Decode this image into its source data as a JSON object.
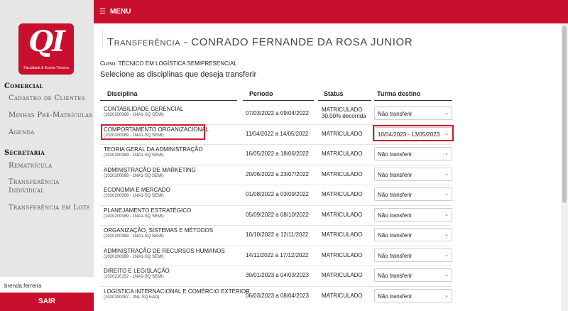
{
  "brand": {
    "logo_text": "QI",
    "logo_subtitle": "Faculdade & Escola Técnica",
    "color": "#c8102e"
  },
  "topbar": {
    "menu_label": "MENU"
  },
  "sidebar": {
    "groups": [
      {
        "title": "Comercial",
        "items": [
          "Cadastro de Clientes",
          "Minhas Pré-Matrículas",
          "Agenda"
        ]
      },
      {
        "title": "Secretaria",
        "items": [
          "Rematrícula",
          "Transferência Individual",
          "Transferência em Lote"
        ]
      }
    ],
    "username": "brenda.ferreira",
    "logout_label": "SAIR"
  },
  "page": {
    "title_prefix": "Transferência",
    "title_rest": " - CONRADO FERNANDE DA ROSA JUNIOR",
    "curso": "Curso: TÉCNICO EM LOGÍSTICA SEMIPRESENCIAL",
    "subheading": "Selecione as disciplinas que deseja transferir"
  },
  "table": {
    "headers": [
      "Disciplina",
      "Período",
      "Status",
      "Turma destino"
    ],
    "rows": [
      {
        "name": "CONTABILIDADE GERENCIAL",
        "code": "(1020200089 - 1NA1-SQ SEMI)",
        "periodo": "07/03/2022 a 09/04/2022",
        "status": "MATRICULADO",
        "status2": "30.00% decorrida",
        "destino": "Não transferir"
      },
      {
        "name": "COMPORTAMENTO ORGANIZACIONAL",
        "code": "(1020200089 - 1NA1-SQ SEMI)",
        "periodo": "11/04/2022 a 14/05/2022",
        "status": "MATRICULADO",
        "status2": "",
        "destino": "10/04/2023 - 13/05/2023"
      },
      {
        "name": "TEORIA GERAL DA ADMINISTRAÇÃO",
        "code": "(1020200089 - 1NA1-SQ SEMI)",
        "periodo": "16/05/2022 a 18/06/2022",
        "status": "MATRICULADO",
        "status2": "",
        "destino": "Não transferir"
      },
      {
        "name": "ADMINISTRAÇÃO DE MARKETING",
        "code": "(1020200089 - 1NA1-SQ SEMI)",
        "periodo": "20/06/2022 a 23/07/2022",
        "status": "MATRICULADO",
        "status2": "",
        "destino": "Não transferir"
      },
      {
        "name": "ECONOMIA E MERCADO",
        "code": "(1020200089 - 1NA1-SQ SEMI)",
        "periodo": "01/08/2022 a 03/09/2022",
        "status": "MATRICULADO",
        "status2": "",
        "destino": "Não transferir"
      },
      {
        "name": "PLANEJAMENTO ESTRATÉGICO",
        "code": "(1020200089 - 1NA1-SQ SEMI)",
        "periodo": "05/09/2022 a 08/10/2022",
        "status": "MATRICULADO",
        "status2": "",
        "destino": "Não transferir"
      },
      {
        "name": "ORGANIZAÇÃO, SISTEMAS E MÉTODOS",
        "code": "(1020200089 - 1NA1-SQ SEMI)",
        "periodo": "10/10/2022 a 12/11/2022",
        "status": "MATRICULADO",
        "status2": "",
        "destino": "Não transferir"
      },
      {
        "name": "ADMINISTRAÇÃO DE RECURSOS HUMANOS",
        "code": "(1020200089 - 1NA1-SQ SEMI)",
        "periodo": "14/11/2022 a 17/12/2022",
        "status": "MATRICULADO",
        "status2": "",
        "destino": "Não transferir"
      },
      {
        "name": "DIREITO E LEGISLAÇÃO",
        "code": "(1020210152 - 1NA2-SQ SEMI)",
        "periodo": "30/01/2023 a 04/03/2023",
        "status": "MATRICULADO",
        "status2": "",
        "destino": "Não transferir"
      },
      {
        "name": "LOGÍSTICA INTERNACIONAL E COMÉRCIO EXTERIOR",
        "code": "(1020200087 - 2NL-SQ EAD)",
        "periodo": "06/03/2023 a 08/04/2023",
        "status": "MATRICULADO",
        "status2": "",
        "destino": "Não transferir"
      }
    ]
  }
}
